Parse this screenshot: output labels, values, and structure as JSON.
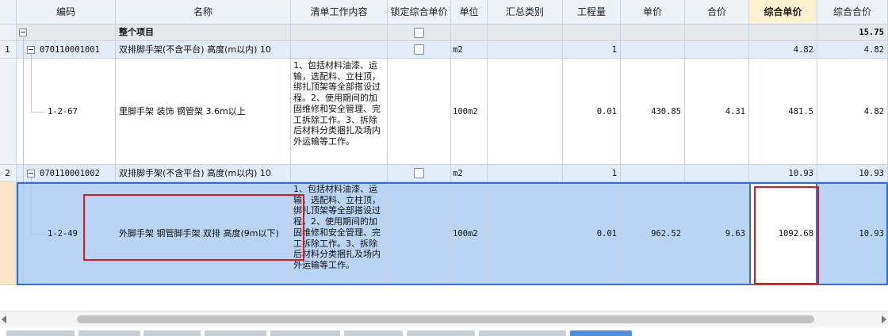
{
  "columns": [
    "编码",
    "名称",
    "清单工作内容",
    "锁定综合单价",
    "单位",
    "汇总类别",
    "工程量",
    "单价",
    "合价",
    "综合单价",
    "综合合价"
  ],
  "active_column": "综合单价",
  "total_row": {
    "toggle": "−",
    "name": "整个项目",
    "composite_total": "15.75"
  },
  "groups": [
    {
      "index": "1",
      "code": "070110001001",
      "name": "双排脚手架(不含平台) 高度(m以内) 10",
      "unit": "m2",
      "quantity": "1",
      "composite_price": "4.82",
      "composite_total": "4.82",
      "child": {
        "code": "1-2-67",
        "name": "里脚手架 装饰 钢管架 3.6m以上",
        "work_content": "1、包括材料油漆、运输，选配料、立柱顶，绑扎顶架等全部搭设过程。2、使用期间的加固维修和安全管理、完工拆除工作。3、拆除后材料分类捆扎及场内外运输等工作。",
        "unit": "100m2",
        "quantity": "0.01",
        "unit_price": "430.85",
        "amount": "4.31",
        "composite_price": "481.5",
        "composite_total": "4.82"
      }
    },
    {
      "index": "2",
      "code": "070110001002",
      "name": "双排脚手架(不含平台) 高度(m以内) 10",
      "unit": "m2",
      "quantity": "1",
      "composite_price": "10.93",
      "composite_total": "10.93",
      "child": {
        "code": "1-2-49",
        "name": "外脚手架 钢管脚手架 双排 高度(9m以下)",
        "work_content": "1、包括材料油漆、运输，选配料、立柱顶，绑扎顶架等全部搭设过程。2、使用期间的加固维修和安全管理、完工拆除工作。3、拆除后材料分类捆扎及场内外运输等工作。",
        "unit": "100m2",
        "quantity": "0.01",
        "unit_price": "962.52",
        "amount": "9.63",
        "composite_price": "1092.68",
        "composite_total": "10.93"
      }
    }
  ],
  "colors": {
    "header_bg": "#eef1f5",
    "active_header_bg": "#fff2d0",
    "group_row_bg": "#e2ecf9",
    "selected_row_bg": "#b9d4f5",
    "highlight_box": "#e0191c",
    "selection_border": "#2f6fd6"
  },
  "icons": {
    "collapse": "minus-box-icon",
    "lock": "checkbox"
  }
}
